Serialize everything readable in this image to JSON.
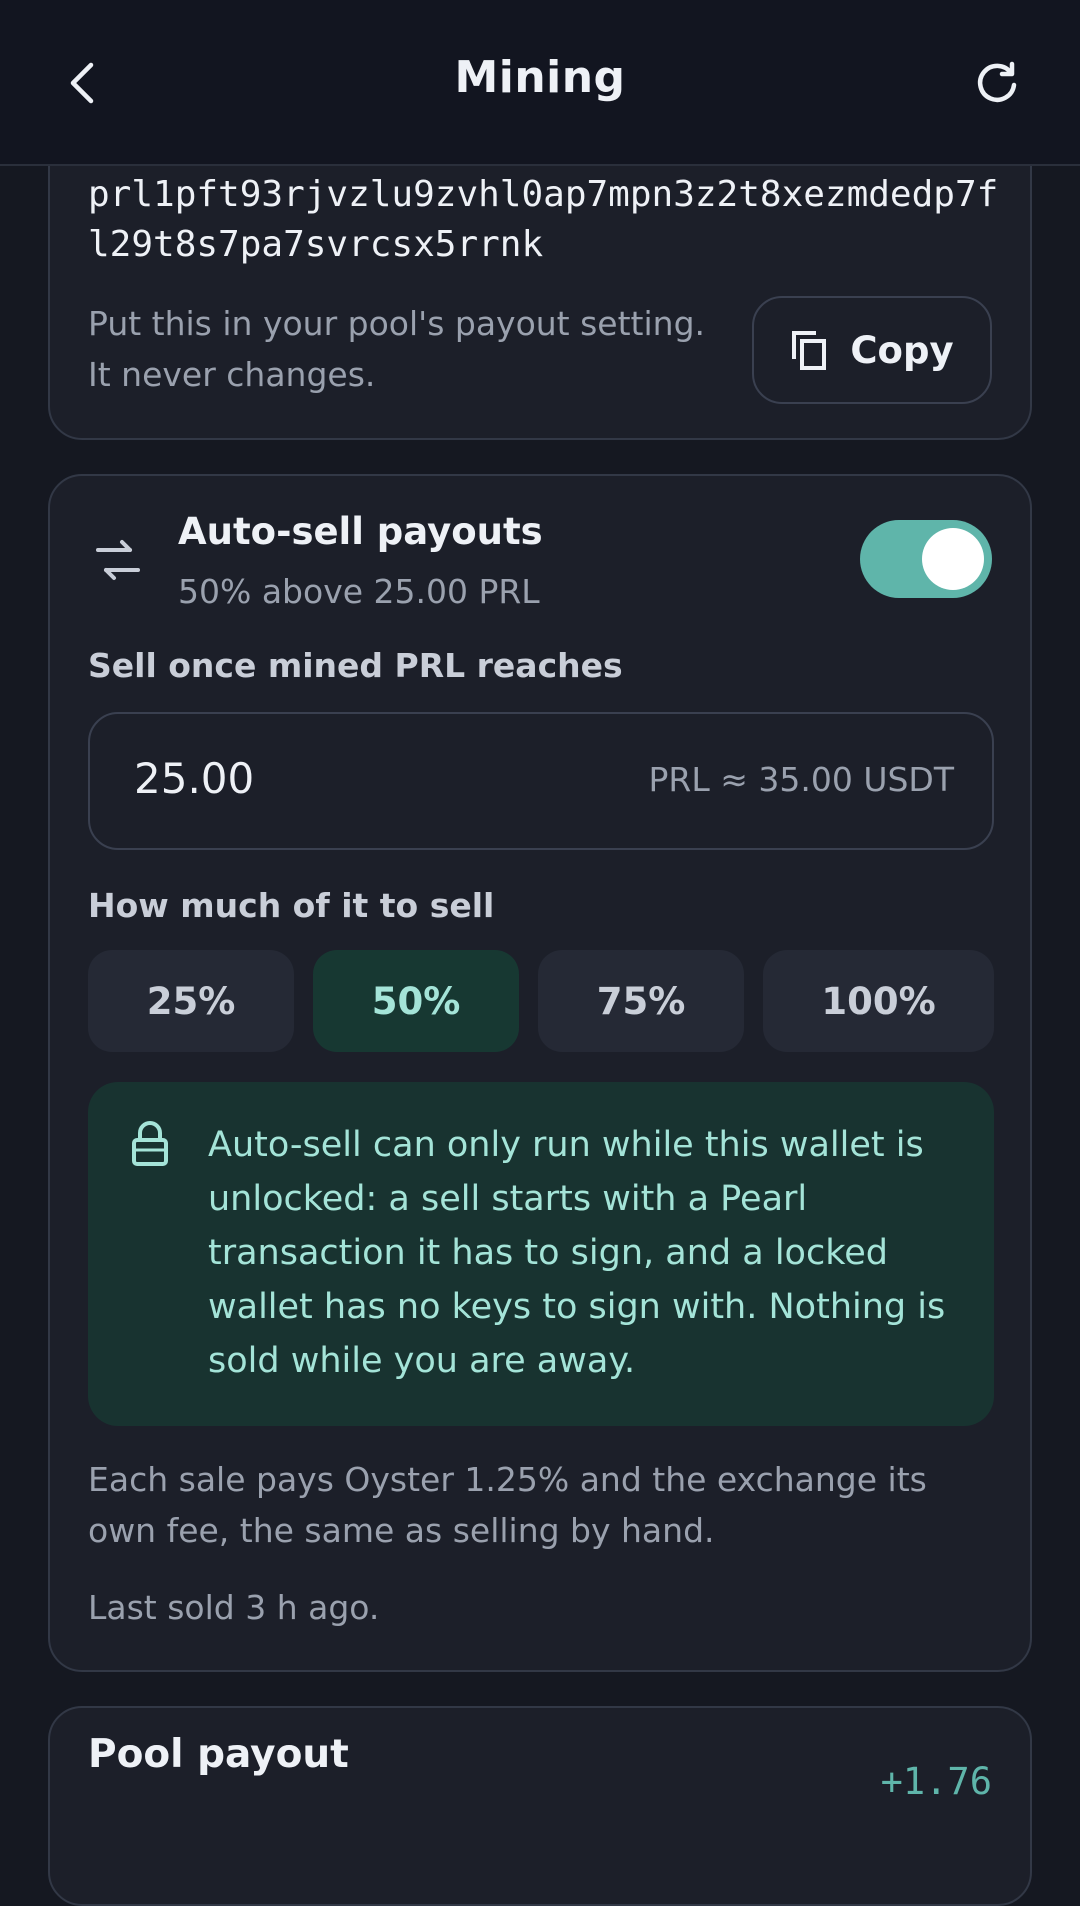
{
  "header": {
    "title": "Mining",
    "back_icon": "chevron-left-icon",
    "refresh_icon": "refresh-icon"
  },
  "address_card": {
    "address": "prl1pft93rjvzlu9zvhl0ap7mpn3z2t8xezmdedp7fl29t8s7pa7svrcsx5rrnk",
    "hint": "Put this in your pool's payout setting. It never changes.",
    "copy_label": "Copy",
    "copy_icon": "copy-icon"
  },
  "autosell": {
    "icon": "swap-arrows-icon",
    "title": "Auto-sell payouts",
    "subtitle": "50% above 25.00 PRL",
    "enabled": true,
    "threshold_label": "Sell once mined PRL reaches",
    "threshold_value": "25.00",
    "threshold_conversion": "PRL ≈ 35.00 USDT",
    "portion_label": "How much of it to sell",
    "portion_options": [
      "25%",
      "50%",
      "75%",
      "100%"
    ],
    "portion_selected": "50%",
    "notice_icon": "lock-icon",
    "notice": "Auto-sell can only run while this wallet is unlocked: a sell starts with a Pearl transaction it has to sign, and a locked wallet has no keys to sign with. Nothing is sold while you are away.",
    "fee_note": "Each sale pays Oyster 1.25% and the exchange its own fee, the same as selling by hand.",
    "last_sold": "Last sold 3 h ago."
  },
  "pool_card": {
    "title": "Pool payout",
    "amount": "+1.76"
  },
  "colors": {
    "background": "#151821",
    "card": "#1c1f29",
    "accent": "#5fb5aa",
    "notice_bg": "#183330",
    "notice_text": "#a4e4d8"
  }
}
